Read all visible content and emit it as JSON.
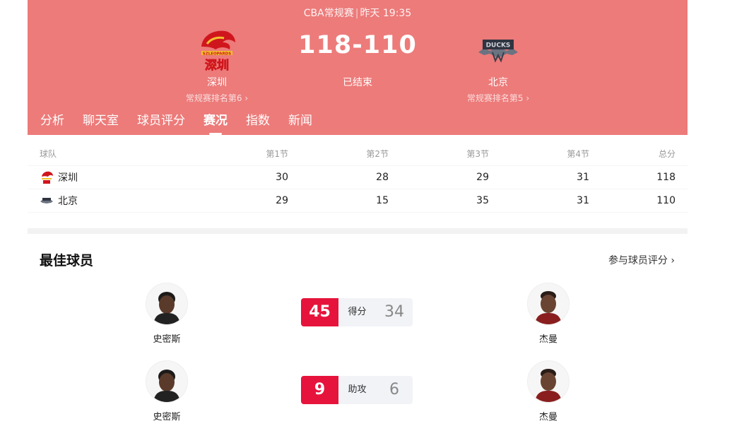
{
  "match": {
    "league": "CBA常规赛",
    "time": "昨天 19:35",
    "score": "118-110",
    "status": "已结束",
    "home": {
      "name": "深圳",
      "rank": "常规赛排名第6 ›",
      "logo_text": "SZLEOPARDS",
      "logo_cn": "深圳",
      "logo_color": "#d0161d"
    },
    "away": {
      "name": "北京",
      "rank": "常规赛排名第5 ›",
      "logo_text": "DUCKS",
      "logo_color": "#4a4f5a"
    }
  },
  "tabs": [
    "分析",
    "聊天室",
    "球员评分",
    "赛况",
    "指数",
    "新闻"
  ],
  "active_tab": "赛况",
  "quarters": {
    "headers": [
      "球队",
      "第1节",
      "第2节",
      "第3节",
      "第4节",
      "总分"
    ],
    "rows": [
      {
        "team": "深圳",
        "scores": [
          "30",
          "28",
          "29",
          "31",
          "118"
        ]
      },
      {
        "team": "北京",
        "scores": [
          "29",
          "15",
          "35",
          "31",
          "110"
        ]
      }
    ]
  },
  "best_players": {
    "title": "最佳球员",
    "rate_link": "参与球员评分 ›",
    "stats": [
      {
        "label": "得分",
        "left_value": "45",
        "right_value": "34",
        "left_player": "史密斯",
        "right_player": "杰曼"
      },
      {
        "label": "助攻",
        "left_value": "9",
        "right_value": "6",
        "left_player": "史密斯",
        "right_player": "杰曼"
      }
    ]
  },
  "colors": {
    "header_bg": "#ec7b7a",
    "accent_red": "#e6143c",
    "stat_bg": "#f2f3f7"
  }
}
